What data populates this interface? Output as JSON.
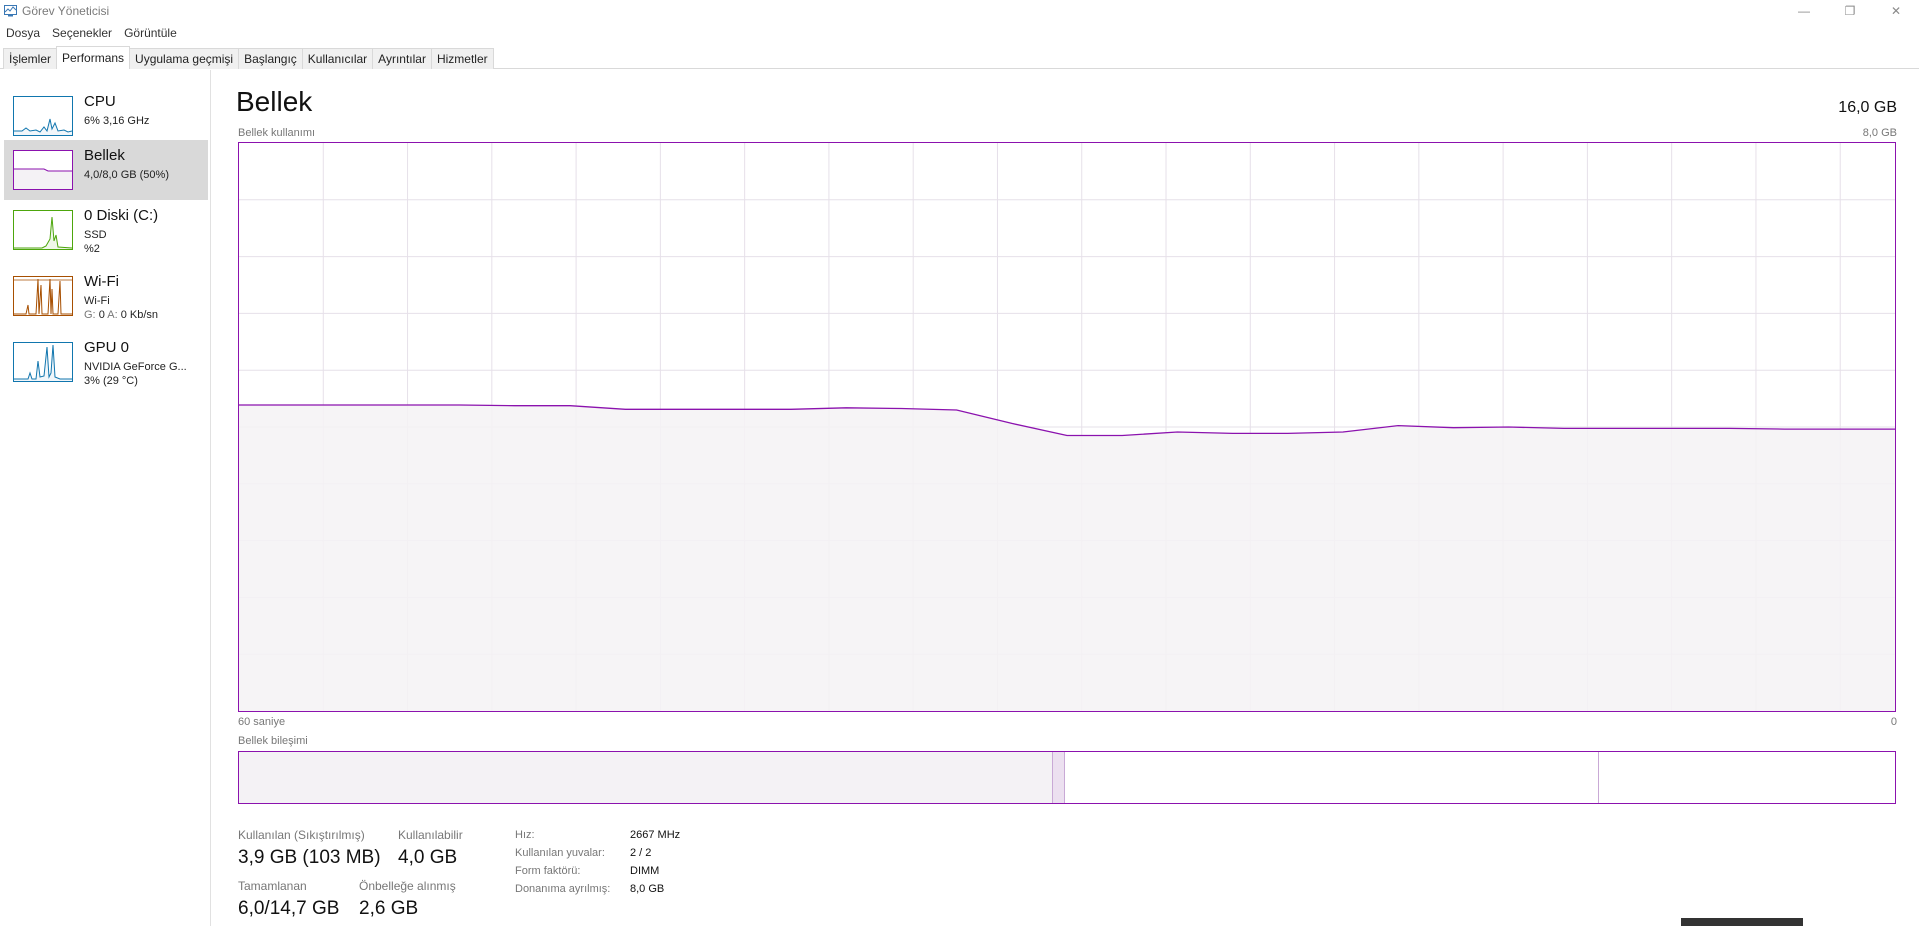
{
  "window": {
    "title": "Görev Yöneticisi",
    "minimize_glyph": "—",
    "restore_glyph": "❐",
    "close_glyph": "✕"
  },
  "menu": [
    "Dosya",
    "Seçenekler",
    "Görüntüle"
  ],
  "tabs": [
    {
      "label": "İşlemler",
      "active": false
    },
    {
      "label": "Performans",
      "active": true
    },
    {
      "label": "Uygulama geçmişi",
      "active": false
    },
    {
      "label": "Başlangıç",
      "active": false
    },
    {
      "label": "Kullanıcılar",
      "active": false
    },
    {
      "label": "Ayrıntılar",
      "active": false
    },
    {
      "label": "Hizmetler",
      "active": false
    }
  ],
  "sidebar": {
    "items": [
      {
        "title": "CPU",
        "lines": [
          "6% 3,16 GHz"
        ],
        "color": "#1176ae",
        "selected": false
      },
      {
        "title": "Bellek",
        "lines": [
          "4,0/8,0 GB (50%)"
        ],
        "color": "#8b12ae",
        "selected": true
      },
      {
        "title": "0 Diski (C:)",
        "lines": [
          "SSD",
          "%2"
        ],
        "color": "#4da60c",
        "selected": false
      },
      {
        "title": "Wi-Fi",
        "lines": [
          "Wi-Fi"
        ],
        "wifi_send_label": "G:",
        "wifi_send": "0",
        "wifi_recv_label": "A:",
        "wifi_recv": "0 Kb/sn",
        "color": "#a74f01",
        "selected": false
      },
      {
        "title": "GPU 0",
        "lines": [
          "NVIDIA GeForce G...",
          "3% (29 °C)"
        ],
        "color": "#1176ae",
        "selected": false
      }
    ]
  },
  "main": {
    "title": "Bellek",
    "total": "16,0 GB",
    "usage_label": "Bellek kullanımı",
    "usage_max": "8,0 GB",
    "time_left": "60 saniye",
    "time_right": "0",
    "composition_label": "Bellek bileşimi"
  },
  "chart_data": {
    "type": "area",
    "color": "#8b12ae",
    "fill": "#f4f2f5",
    "ylim": [
      0,
      8.0
    ],
    "xlim": [
      60,
      0
    ],
    "grid": true,
    "x": [
      60,
      58,
      56,
      54,
      52,
      50,
      48,
      46,
      44,
      42,
      40,
      38,
      36,
      34,
      32,
      30,
      28,
      26,
      24,
      22,
      20,
      18,
      16,
      14,
      12,
      10,
      8,
      6,
      4,
      2,
      0
    ],
    "y": [
      4.31,
      4.31,
      4.31,
      4.31,
      4.31,
      4.3,
      4.3,
      4.25,
      4.25,
      4.25,
      4.25,
      4.27,
      4.26,
      4.24,
      4.05,
      3.88,
      3.88,
      3.93,
      3.91,
      3.91,
      3.93,
      4.02,
      3.99,
      4.0,
      3.98,
      3.98,
      3.98,
      3.98,
      3.97,
      3.97,
      3.97
    ]
  },
  "composition": {
    "used_fraction": 0.491,
    "modified_fraction": 0.008,
    "standby_fraction": 0.322
  },
  "stats": {
    "in_use_label": "Kullanılan (Sıkıştırılmış)",
    "in_use_value": "3,9 GB (103 MB)",
    "available_label": "Kullanılabilir",
    "available_value": "4,0 GB",
    "committed_label": "Tamamlanan",
    "committed_value": "6,0/14,7 GB",
    "cached_label": "Önbelleğe alınmış",
    "cached_value": "2,6 GB"
  },
  "details": [
    {
      "label": "Hız:",
      "value": "2667 MHz"
    },
    {
      "label": "Kullanılan yuvalar:",
      "value": "2 / 2"
    },
    {
      "label": "Form faktörü:",
      "value": "DIMM"
    },
    {
      "label": "Donanıma ayrılmış:",
      "value": "8,0 GB"
    }
  ]
}
